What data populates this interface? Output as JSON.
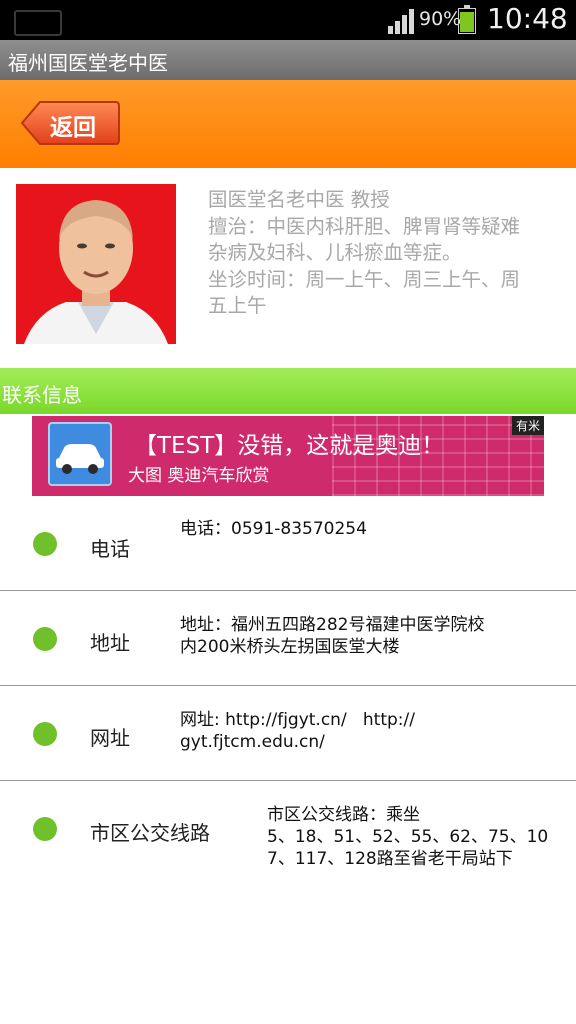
{
  "status_bar": {
    "battery_percent": "90%",
    "battery_level": 0.9,
    "time": "10:48"
  },
  "app": {
    "title": "福州国医堂老中医"
  },
  "header": {
    "back_label": "返回"
  },
  "doctor": {
    "line1": "国医堂名老中医 教授",
    "line2": "擅治：中医内科肝胆、脾胃肾等疑难",
    "line3": "杂病及妇科、儿科瘀血等症。",
    "line4": "坐诊时间：周一上午、周三上午、周",
    "line5": "五上午"
  },
  "section": {
    "title": "联系信息"
  },
  "ad": {
    "headline": "【TEST】没错，这就是奥迪！",
    "subtitle": "大图 奥迪汽车欣赏",
    "tag": "有米"
  },
  "contacts": [
    {
      "label": "电话",
      "lines": [
        "电话：0591-83570254"
      ]
    },
    {
      "label": "地址",
      "lines": [
        "地址：福州五四路282号福建中医学院校",
        "内200米桥头左拐国医堂大楼"
      ]
    },
    {
      "label": "网址",
      "lines": [
        "网址: http://fjgyt.cn/   http://",
        "gyt.fjtcm.edu.cn/"
      ]
    },
    {
      "label": "市区公交线路",
      "lines": [
        "市区公交线路：乘坐",
        "5、18、51、52、55、62、75、10",
        "7、117、128路至省老干局站下"
      ]
    }
  ]
}
